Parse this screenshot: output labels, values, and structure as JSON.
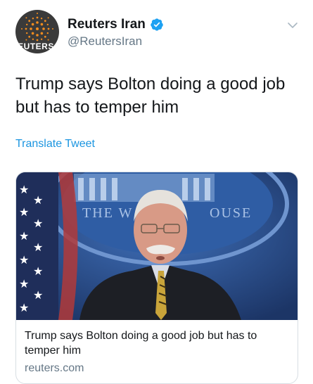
{
  "account": {
    "display_name": "Reuters Iran",
    "handle": "@ReutersIran",
    "avatar_text": "REUTERS",
    "verified_icon": "verified-badge-icon"
  },
  "tweet": {
    "text": "Trump says Bolton doing a good job but has to temper him",
    "translate_label": "Translate Tweet"
  },
  "card": {
    "image_text": "THE WHITE HOUSE",
    "title": "Trump says Bolton doing a good job but has to temper him",
    "domain": "reuters.com"
  },
  "colors": {
    "link": "#1b95e0",
    "verified": "#1da1f2",
    "secondary_text": "#657786",
    "primary_text": "#14171a"
  }
}
